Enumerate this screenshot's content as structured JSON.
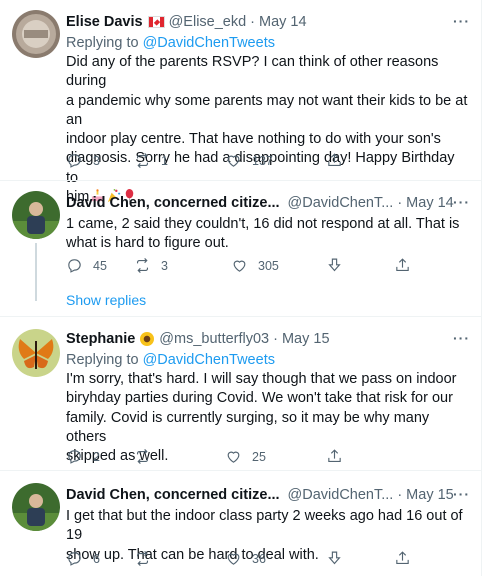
{
  "tweets": [
    {
      "name": "Elise Davis",
      "handle": "@Elise_ekd",
      "separator": "·",
      "date": "May 14",
      "more": "···",
      "replying_prefix": "Replying to",
      "replying_handle": "@DavidChenTweets",
      "lines": [
        "Did any of the parents RSVP? I can think of other reasons during",
        "a pandemic why some parents may not want their kids to be at an",
        "indoor play centre. That have nothing to do with your son's",
        "diagnosis. Sorry he had a disappointing day!  Happy Birthday to",
        "him"
      ],
      "emojis": [
        "birthday-cake",
        "party-popper",
        "balloon"
      ],
      "flag": "canada",
      "actions": {
        "replies": "3",
        "retweets": "1",
        "likes": "137"
      }
    },
    {
      "name": "David Chen, concerned citize...",
      "handle": "@DavidChenT...",
      "separator": "·",
      "date": "May 14",
      "more": "···",
      "lines": [
        "1 came, 2 said they couldn't, 16 did not respond at all. That is",
        "what is hard to figure out."
      ],
      "actions": {
        "replies": "45",
        "retweets": "3",
        "likes": "305"
      }
    },
    {
      "name": "Stephanie",
      "handle": "@ms_butterfly03",
      "separator": "·",
      "date": "May 15",
      "more": "···",
      "replying_prefix": "Replying to",
      "replying_handle": "@DavidChenTweets",
      "lines": [
        "I'm sorry, that's hard. I will say though that we pass on indoor",
        "biryhday parties during Covid. We won't take that risk for our",
        "family. Covid is currently surging, so it may be why many others",
        "skipped as well."
      ],
      "emojis": [
        "sunflower"
      ],
      "actions": {
        "replies": "2",
        "retweets": "",
        "likes": "25"
      }
    },
    {
      "name": "David Chen, concerned citize...",
      "handle": "@DavidChenT...",
      "separator": "·",
      "date": "May 15",
      "more": "···",
      "lines": [
        "I get that but the indoor class party 2 weeks ago had 16 out of 19",
        "show up. That can be hard to deal with."
      ],
      "actions": {
        "replies": "6",
        "retweets": "",
        "likes": "36"
      }
    }
  ],
  "show_replies": "Show replies",
  "colors": {
    "link": "#1d9bf0",
    "secondary": "#536471",
    "text": "#0f1419",
    "divider": "#eff3f4"
  }
}
